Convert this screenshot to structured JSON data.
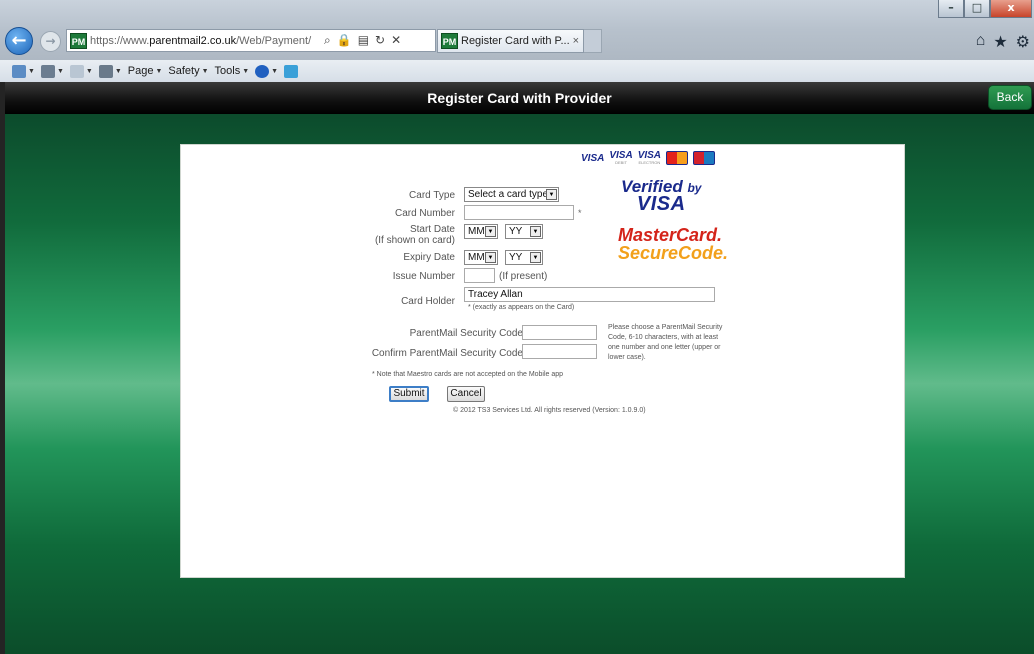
{
  "browser": {
    "url_prefix": "https://www.",
    "url_domain": "parentmail2.co.uk",
    "url_path": "/Web/Payment/",
    "tab_title": "Register Card with P...",
    "tab_close": "×",
    "pm_icon": "PM",
    "back_glyph": "←",
    "forward_glyph": "→",
    "window_controls": [
      "–",
      "□",
      "x"
    ],
    "right_icons": [
      "home-icon",
      "favorites-icon",
      "settings-icon"
    ],
    "command_bar": [
      "Page",
      "Safety",
      "Tools"
    ]
  },
  "header": {
    "title": "Register Card with Provider",
    "back_label": "Back"
  },
  "logos": {
    "visa_text": "VISA",
    "visa_debit_sub": "DEBIT",
    "visa_electron_sub": "ELECTRON",
    "verified_line1": "Verified",
    "verified_by": "by",
    "verified_line2": "VISA",
    "mc_line1": "MasterCard.",
    "mc_line2": "SecureCode."
  },
  "form": {
    "card_type_label": "Card Type",
    "card_type_value": "Select a card type",
    "card_number_label": "Card Number",
    "card_number_value": "",
    "required_mark": "*",
    "start_date_label": "Start Date",
    "start_date_sub": "(If shown on card)",
    "start_month": "MM",
    "start_year": "YY",
    "expiry_date_label": "Expiry Date",
    "expiry_month": "MM",
    "expiry_year": "YY",
    "issue_number_label": "Issue Number",
    "issue_number_hint": "(If present)",
    "card_holder_label": "Card Holder",
    "card_holder_value": "Tracey Allan",
    "card_holder_note": "* (exactly as appears on the Card)",
    "security_code_label": "ParentMail Security Code",
    "confirm_code_label": "Confirm ParentMail Security Code",
    "security_help": "Please choose a ParentMail Security Code, 6-10 characters, with at least one number and one letter (upper or lower case).",
    "maestro_note": "* Note that Maestro cards are not accepted on the Mobile app",
    "submit_label": "Submit",
    "cancel_label": "Cancel",
    "copyright": "© 2012 TS3 Services Ltd. All rights reserved (Version: 1.0.9.0)"
  }
}
